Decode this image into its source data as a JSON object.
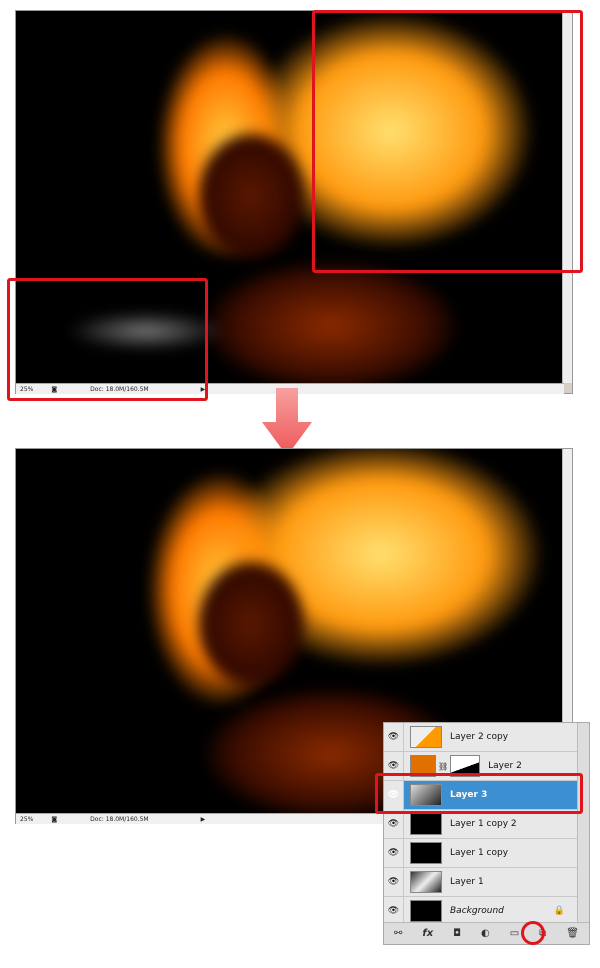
{
  "top_window": {
    "zoom": "25%",
    "doc_info": "Doc: 18.0M/160.5M"
  },
  "bottom_window": {
    "zoom": "25%",
    "doc_info": "Doc: 18.0M/160.5M"
  },
  "layers_panel": {
    "layers": [
      {
        "name": "Layer 2 copy",
        "visible": true,
        "selected": false,
        "italic": false
      },
      {
        "name": "Layer 2",
        "visible": true,
        "selected": false,
        "italic": false,
        "has_mask": true
      },
      {
        "name": "Layer 3",
        "visible": true,
        "selected": true,
        "italic": false
      },
      {
        "name": "Layer 1 copy 2",
        "visible": true,
        "selected": false,
        "italic": false
      },
      {
        "name": "Layer 1 copy",
        "visible": true,
        "selected": false,
        "italic": false
      },
      {
        "name": "Layer 1",
        "visible": true,
        "selected": false,
        "italic": false
      },
      {
        "name": "Background",
        "visible": true,
        "selected": false,
        "italic": true,
        "locked": true
      }
    ],
    "footer_icons": [
      "link-icon",
      "fx-icon",
      "mask-icon",
      "adjustment-icon",
      "folder-icon",
      "new-layer-icon",
      "trash-icon"
    ],
    "footer_glyphs": [
      "⚯",
      "fx",
      "◘",
      "◐",
      "▭",
      "⧉",
      "🗑"
    ]
  },
  "colors": {
    "highlight": "#e0141c",
    "selection": "#3c8fd0",
    "arrow": "#f47a7a"
  }
}
